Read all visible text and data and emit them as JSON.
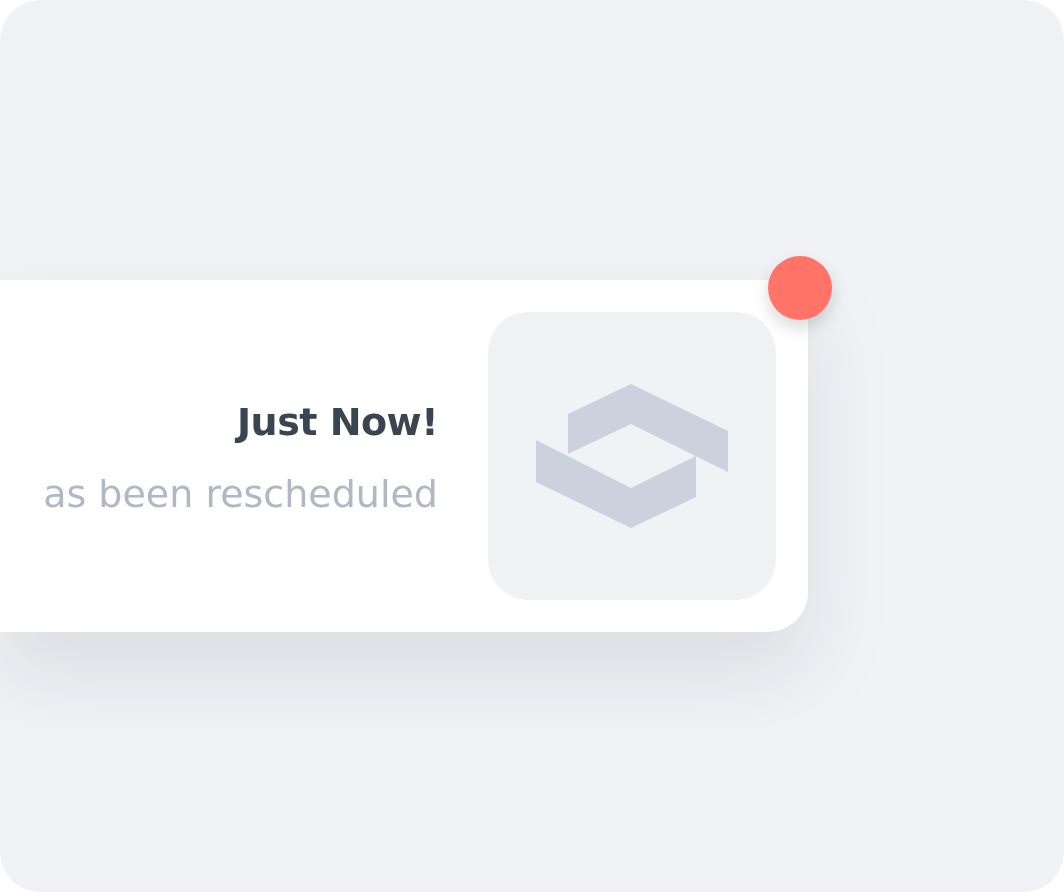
{
  "notification": {
    "time": "Just Now!",
    "message": "as been rescheduled",
    "unread": true
  }
}
